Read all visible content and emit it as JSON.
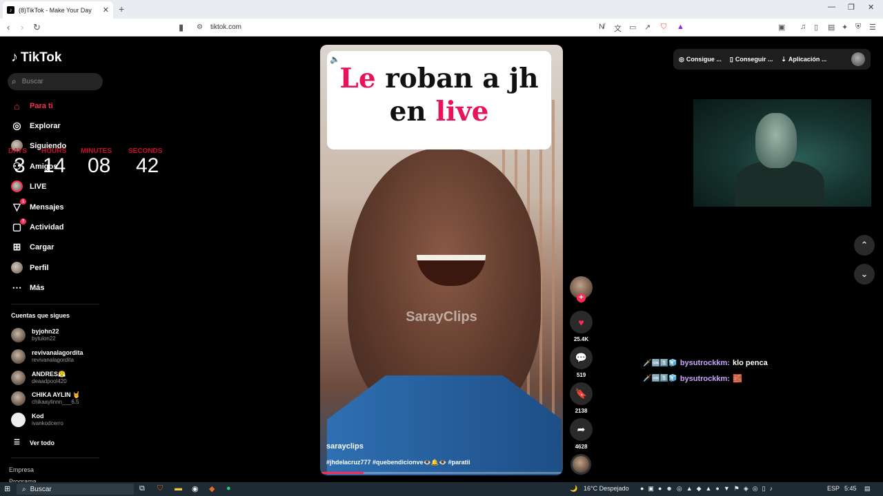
{
  "browser": {
    "tab_title": "(8)TikTok - Make Your Day",
    "url": "tiktok.com"
  },
  "sidebar": {
    "logo": "TikTok",
    "search_placeholder": "Buscar",
    "nav": [
      {
        "label": "Para ti",
        "icon": "home-icon",
        "active": true
      },
      {
        "label": "Explorar",
        "icon": "compass-icon"
      },
      {
        "label": "Siguiendo",
        "icon": "following-icon"
      },
      {
        "label": "Amigos",
        "icon": "friends-icon"
      },
      {
        "label": "LIVE",
        "icon": "live-icon"
      },
      {
        "label": "Mensajes",
        "icon": "message-icon",
        "badge": "1"
      },
      {
        "label": "Actividad",
        "icon": "activity-icon",
        "badge": "7"
      },
      {
        "label": "Cargar",
        "icon": "upload-icon"
      },
      {
        "label": "Perfil",
        "icon": "profile-icon"
      },
      {
        "label": "Más",
        "icon": "more-icon"
      }
    ],
    "following_title": "Cuentas que sigues",
    "following": [
      {
        "name": "byjohn22",
        "handle": "bytulon22"
      },
      {
        "name": "revivanalagordita",
        "handle": "revivanalagordita"
      },
      {
        "name": "ANDRES😤",
        "handle": "deaadpool420"
      },
      {
        "name": "CHIKA AYLIN 🤘",
        "handle": "chikaaylinnn___6.5"
      },
      {
        "name": "Kod",
        "handle": "ivankodcerro"
      }
    ],
    "see_all": "Ver todo",
    "footer_link_1": "Empresa",
    "footer_link_2": "Programa"
  },
  "countdown": {
    "labels": {
      "days": "DAYS",
      "hours": "HOURS",
      "minutes": "MINUTES",
      "seconds": "SECONDS"
    },
    "values": {
      "days": "3",
      "hours": "14",
      "minutes": "08",
      "seconds": "42"
    }
  },
  "video": {
    "title_part1": "Le",
    "title_part2": " roban a jh",
    "title_part3": "en ",
    "title_part4": "live",
    "watermark": "SarayClips",
    "author": "sarayclips",
    "hashtags": "#jhdelacruz777  #quebendicionve👁️🔔👁️  #paratii",
    "progress": 0.18
  },
  "actions": {
    "likes": "25.4K",
    "comments": "519",
    "saves": "2138",
    "shares": "4628"
  },
  "top_actions": {
    "coins": "Consigue ...",
    "app_get": "Conseguir ...",
    "app": "Aplicación ..."
  },
  "chat": [
    {
      "badges": "🗡️🆒1️⃣🧊",
      "user": "bysutrockkm:",
      "message": "klo penca"
    },
    {
      "badges": "🗡️🆒1️⃣🧊",
      "user": "bysutrockkm:",
      "message": "🧱"
    }
  ],
  "taskbar": {
    "search": "Buscar",
    "weather": "16°C  Despejado",
    "lang": "ESP",
    "time": "5:45"
  }
}
